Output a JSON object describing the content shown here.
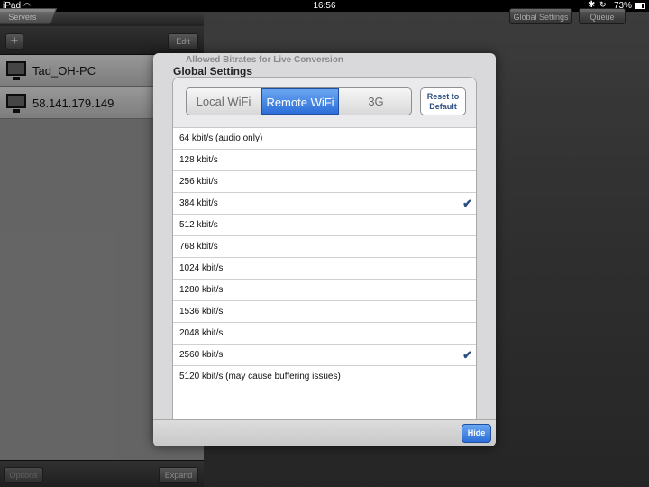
{
  "status_bar": {
    "carrier": "iPad",
    "time": "16:56",
    "battery_percent": "73%",
    "battery_level": 0.73
  },
  "master": {
    "tab_label": "Servers",
    "edit_label": "Edit",
    "add_label": "+",
    "servers": [
      {
        "name": "Tad_OH-PC"
      },
      {
        "name": "58.141.179.149"
      }
    ],
    "options_label": "Options",
    "expand_label": "Expand"
  },
  "detail": {
    "global_settings_label": "Global Settings",
    "queue_label": "Queue"
  },
  "modal": {
    "ghost_title": "Allowed Bitrates for Live Conversion",
    "title": "Global Settings",
    "segments": [
      {
        "label": "Local WiFi",
        "selected": false
      },
      {
        "label": "Remote WiFi",
        "selected": true
      },
      {
        "label": "3G",
        "selected": false
      }
    ],
    "reset_label_line1": "Reset to",
    "reset_label_line2": "Default",
    "bitrates": [
      {
        "label": "64 kbit/s (audio only)",
        "checked": false
      },
      {
        "label": "128 kbit/s",
        "checked": false
      },
      {
        "label": "256 kbit/s",
        "checked": false
      },
      {
        "label": "384 kbit/s",
        "checked": true
      },
      {
        "label": "512 kbit/s",
        "checked": false
      },
      {
        "label": "768 kbit/s",
        "checked": false
      },
      {
        "label": "1024 kbit/s",
        "checked": false
      },
      {
        "label": "1280 kbit/s",
        "checked": false
      },
      {
        "label": "1536 kbit/s",
        "checked": false
      },
      {
        "label": "2048 kbit/s",
        "checked": false
      },
      {
        "label": "2560 kbit/s",
        "checked": true
      },
      {
        "label": "5120 kbit/s (may cause buffering issues)",
        "checked": false
      }
    ],
    "hide_label": "Hide"
  },
  "colors": {
    "accent_blue": "#2c6fd9",
    "check_blue": "#2c4d80"
  }
}
